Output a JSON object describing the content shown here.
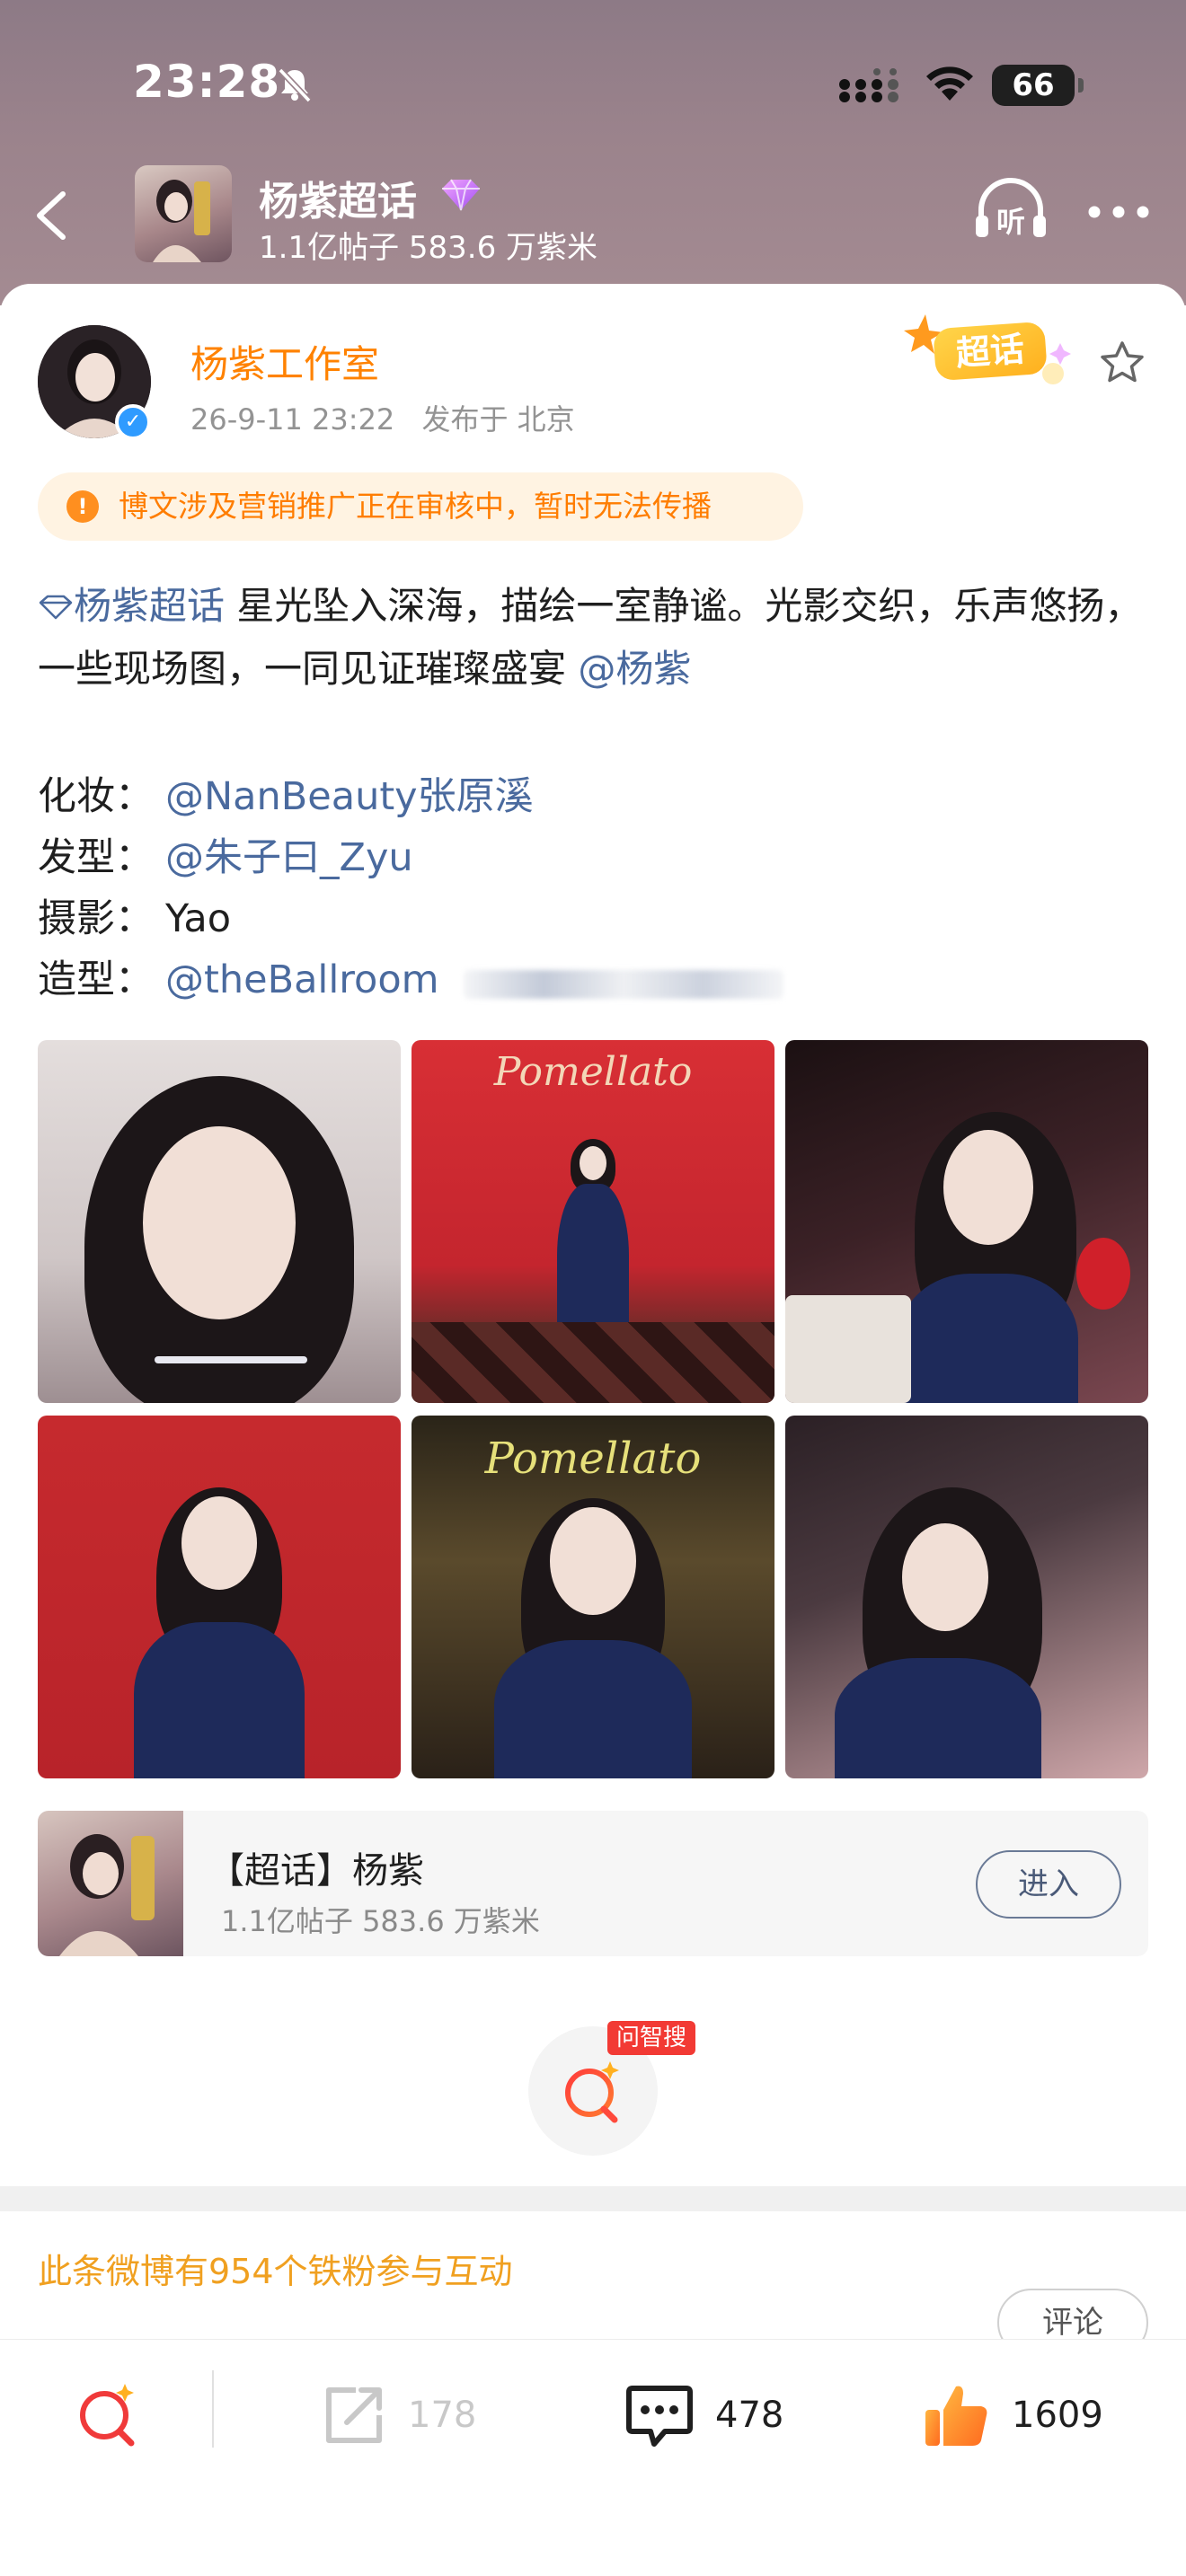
{
  "status_bar": {
    "time": "23:28",
    "battery": "66",
    "icons": [
      "bell-off-icon",
      "signal-icon",
      "wifi-icon",
      "battery-icon"
    ]
  },
  "nav": {
    "topic_title": "杨紫超话",
    "topic_stats": "1.1亿帖子 583.6 万紫米",
    "listen_label": "听"
  },
  "post": {
    "author": "杨紫工作室",
    "date": "26-9-11 23:22",
    "location": "发布于 北京",
    "badge_label": "超话",
    "notice": "博文涉及营销推广正在审核中，暂时无法传播",
    "topic_tag": "杨紫超话",
    "text_main": " 星光坠入深海，描绘一室静谧。光影交织，乐声悠扬，一些现场图，一同见证璀璨盛宴",
    "mention": "@杨紫",
    "credits": [
      {
        "label": "化妆：",
        "value": "@NanBeauty张原溪",
        "is_link": true
      },
      {
        "label": "发型：",
        "value": "@朱子曰_Zyu",
        "is_link": true
      },
      {
        "label": "摄影：",
        "value": "Yao",
        "is_link": false
      },
      {
        "label": "造型：",
        "value": "@theBallroom",
        "is_link": true
      }
    ],
    "photo_brand": "Pomellato"
  },
  "topic_card": {
    "title": "【超话】杨紫",
    "stats": "1.1亿帖子 583.6 万紫米",
    "enter_label": "进入"
  },
  "ask": {
    "tag": "问智搜"
  },
  "interaction": {
    "fan_line": "此条微博有954个铁粉参与互动",
    "comment_button": "评论"
  },
  "toolbar": {
    "repost_count": "178",
    "comment_count": "478",
    "like_count": "1609"
  },
  "colors": {
    "accent_orange": "#ff8200",
    "link_blue": "#4a6a9e",
    "notice_bg": "#fff3e2",
    "like_orange": "#ff8a1f"
  }
}
